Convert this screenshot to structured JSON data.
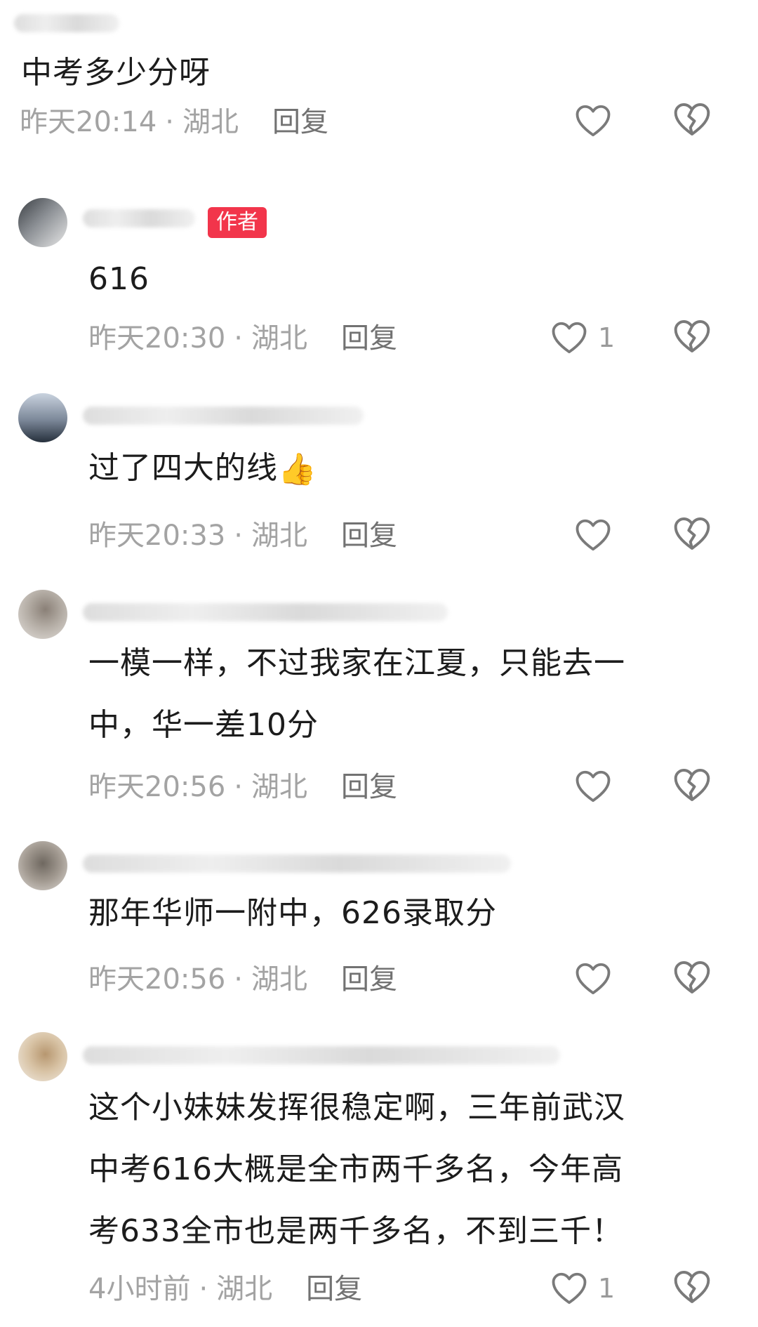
{
  "comments": [
    {
      "content": "中考多少分呀",
      "time": "昨天20:14",
      "location": "湖北",
      "reply_label": "回复",
      "likes": ""
    },
    {
      "badge": "作者",
      "content": "616",
      "time": "昨天20:30",
      "location": "湖北",
      "reply_label": "回复",
      "likes": "1"
    },
    {
      "content": "过了四大的线",
      "emoji": "👍",
      "time": "昨天20:33",
      "location": "湖北",
      "reply_label": "回复",
      "likes": ""
    },
    {
      "content_line1": "一模一样，不过我家在江夏，只能去一",
      "content_line2": "中，华一差10分",
      "time": "昨天20:56",
      "location": "湖北",
      "reply_label": "回复",
      "likes": ""
    },
    {
      "content": "那年华师一附中，626录取分",
      "time": "昨天20:56",
      "location": "湖北",
      "reply_label": "回复",
      "likes": ""
    },
    {
      "content_line1": "这个小妹妹发挥很稳定啊，三年前武汉",
      "content_line2": "中考616大概是全市两千多名，今年高",
      "content_line3": "考633全市也是两千多名，不到三千！",
      "time": "4小时前",
      "location": "湖北",
      "reply_label": "回复",
      "likes": "1"
    }
  ],
  "separator": "·",
  "icons": {
    "like": "heart-outline-icon",
    "dislike": "broken-heart-icon"
  },
  "colors": {
    "badge": "#f2354b",
    "meta_text": "#a3a3a3",
    "icon_stroke": "#7a7a7a"
  }
}
